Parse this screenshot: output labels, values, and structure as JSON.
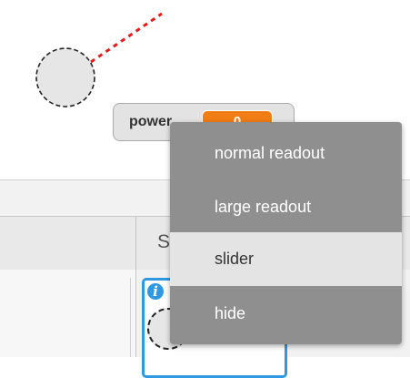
{
  "stage": {
    "sprite_shape": "circle-outline-sprite",
    "direction_line_color": "#e31b1b"
  },
  "watcher": {
    "label": "power",
    "value": "0",
    "value_color": "#f07d15"
  },
  "context_menu": {
    "items": [
      {
        "label": "normal readout",
        "highlighted": false
      },
      {
        "label": "large readout",
        "highlighted": false
      },
      {
        "label": "slider",
        "highlighted": true
      },
      {
        "label": "hide",
        "highlighted": false
      }
    ]
  },
  "sprite_pane": {
    "header_partial_text": "S",
    "info_icon": "i",
    "selection_color": "#2f98e0"
  }
}
